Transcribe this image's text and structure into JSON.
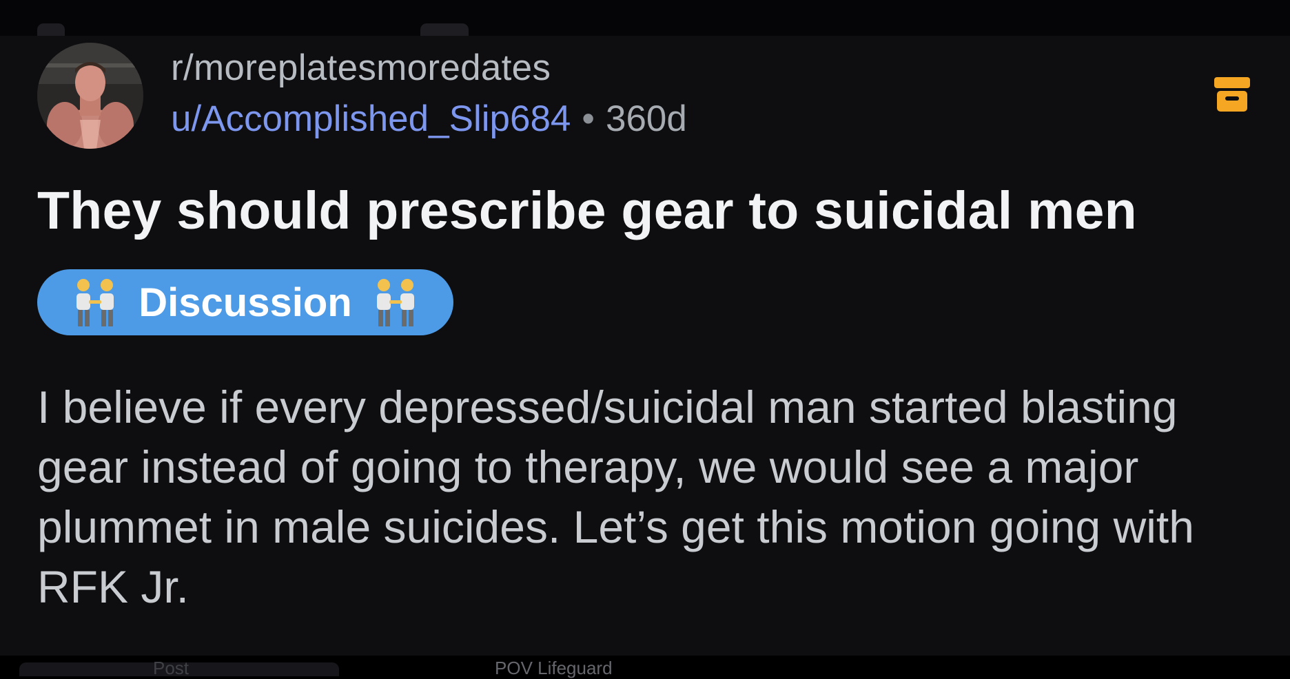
{
  "post": {
    "subreddit": "r/moreplatesmoredates",
    "username": "u/Accomplished_Slip684",
    "separator": "•",
    "age": "360d",
    "title": "They should prescribe gear to suicidal men",
    "flair": {
      "label": "Discussion",
      "emoji": "👬",
      "background_color": "#4d9be6"
    },
    "body": "I believe if every depressed/suicidal man started blasting gear instead of going to therapy, we would see a major plummet in male suicides. Let’s get this motion going with RFK Jr.",
    "archive_icon": "archive-icon",
    "archive_icon_color": "#f5a623"
  },
  "bottom_bar": {
    "tab_label": "Post",
    "caption": "POV Lifeguard"
  },
  "colors": {
    "card_background": "#0e0e11",
    "username": "#7d96ee",
    "title": "#f2f3f5",
    "body": "#c9ccd0"
  }
}
